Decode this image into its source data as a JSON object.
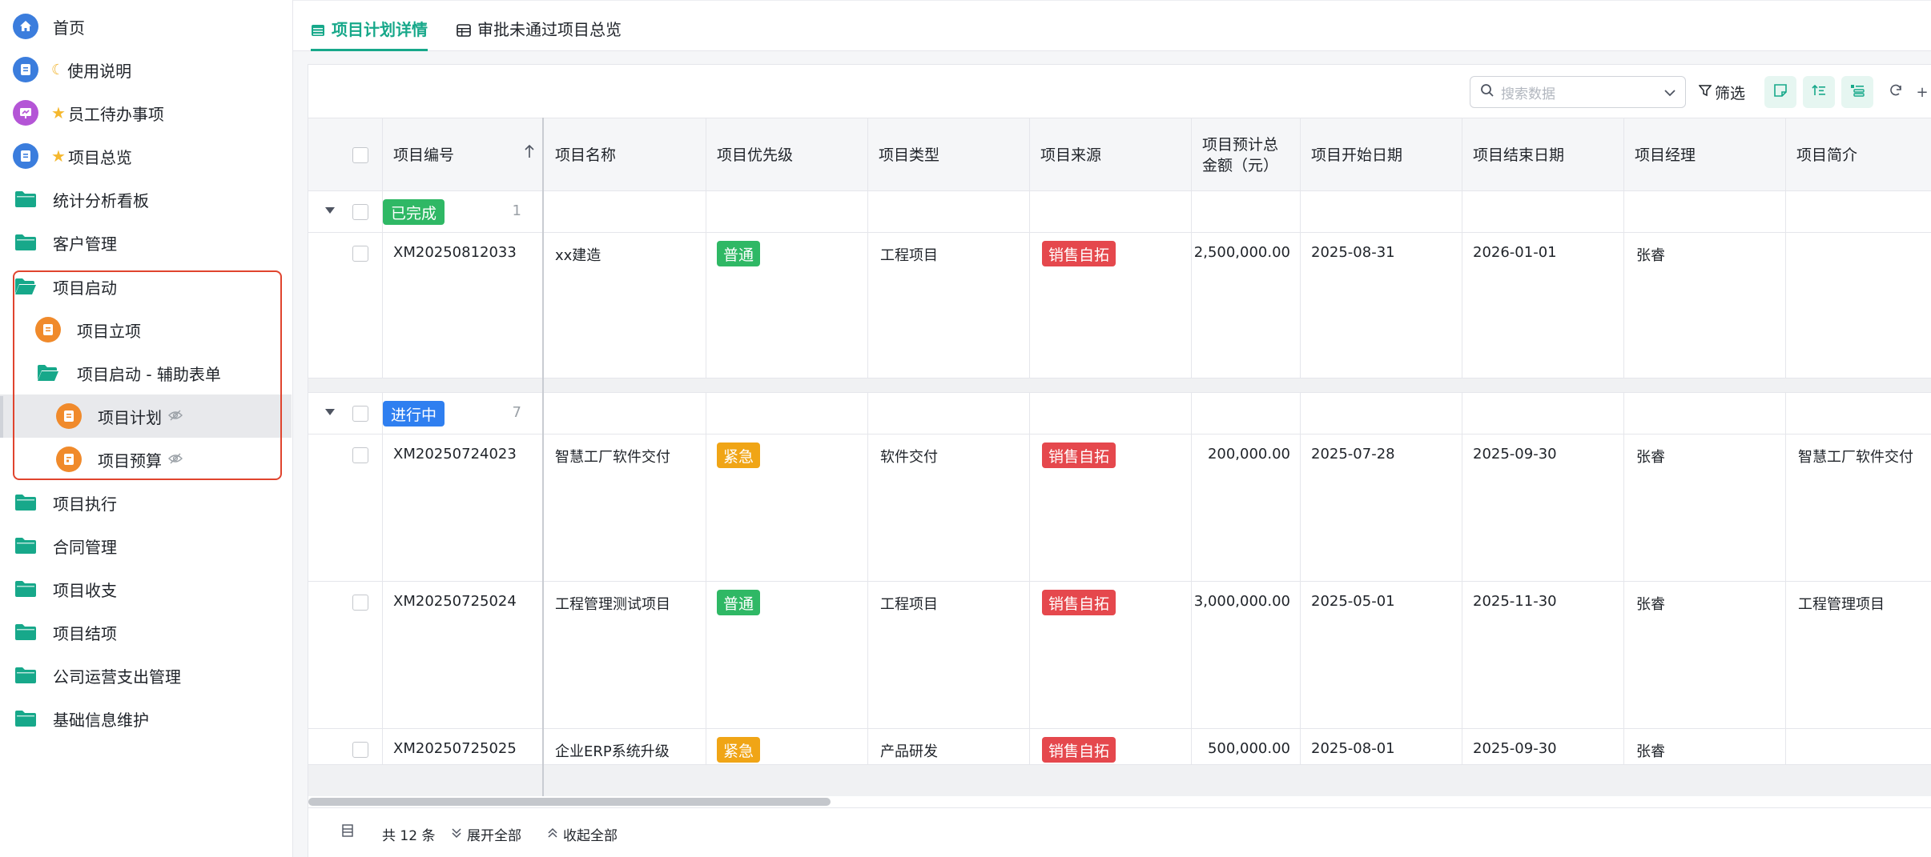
{
  "sidebar": {
    "items": [
      {
        "label": "首页"
      },
      {
        "label": "使用说明"
      },
      {
        "label": "员工待办事项"
      },
      {
        "label": "项目总览"
      },
      {
        "label": "统计分析看板"
      },
      {
        "label": "客户管理"
      },
      {
        "label": "项目启动"
      },
      {
        "label": "项目立项"
      },
      {
        "label": "项目启动 - 辅助表单"
      },
      {
        "label": "项目计划"
      },
      {
        "label": "项目预算"
      },
      {
        "label": "项目执行"
      },
      {
        "label": "合同管理"
      },
      {
        "label": "项目收支"
      },
      {
        "label": "项目结项"
      },
      {
        "label": "公司运营支出管理"
      },
      {
        "label": "基础信息维护"
      }
    ]
  },
  "tabs": [
    {
      "label": "项目计划详情",
      "active": true
    },
    {
      "label": "审批未通过项目总览",
      "active": false
    }
  ],
  "toolbar": {
    "search_placeholder": "搜索数据",
    "filter_label": "筛选"
  },
  "table": {
    "columns": [
      "项目编号",
      "项目名称",
      "项目优先级",
      "项目类型",
      "项目来源",
      "项目预计总金额（元）",
      "项目开始日期",
      "项目结束日期",
      "项目经理",
      "项目简介"
    ],
    "groups": [
      {
        "status": "已完成",
        "count": "1",
        "rows": [
          {
            "id": "XM20250812033",
            "name": "xx建造",
            "priority": "普通",
            "type": "工程项目",
            "source": "销售自拓",
            "amount": "2,500,000.00",
            "start": "2025-08-31",
            "end": "2026-01-01",
            "manager": "张睿",
            "intro": ""
          }
        ]
      },
      {
        "status": "进行中",
        "count": "7",
        "rows": [
          {
            "id": "XM20250724023",
            "name": "智慧工厂软件交付",
            "priority": "紧急",
            "type": "软件交付",
            "source": "销售自拓",
            "amount": "200,000.00",
            "start": "2025-07-28",
            "end": "2025-09-30",
            "manager": "张睿",
            "intro": "智慧工厂软件交付"
          },
          {
            "id": "XM20250725024",
            "name": "工程管理测试项目",
            "priority": "普通",
            "type": "工程项目",
            "source": "销售自拓",
            "amount": "3,000,000.00",
            "start": "2025-05-01",
            "end": "2025-11-30",
            "manager": "张睿",
            "intro": "工程管理项目"
          },
          {
            "id": "XM20250725025",
            "name": "企业ERP系统升级",
            "priority": "紧急",
            "type": "产品研发",
            "source": "销售自拓",
            "amount": "500,000.00",
            "start": "2025-08-01",
            "end": "2025-09-30",
            "manager": "张睿",
            "intro": ""
          }
        ]
      }
    ]
  },
  "footer": {
    "total": "共 12 条",
    "expand_all": "展开全部",
    "collapse_all": "收起全部"
  },
  "colors": {
    "accent": "#17a88a",
    "tag_normal": "#2fb865",
    "tag_urgent": "#f0a516",
    "tag_source": "#e5484d",
    "group_in_progress": "#2f7ff0",
    "highlight": "#e0442e"
  }
}
